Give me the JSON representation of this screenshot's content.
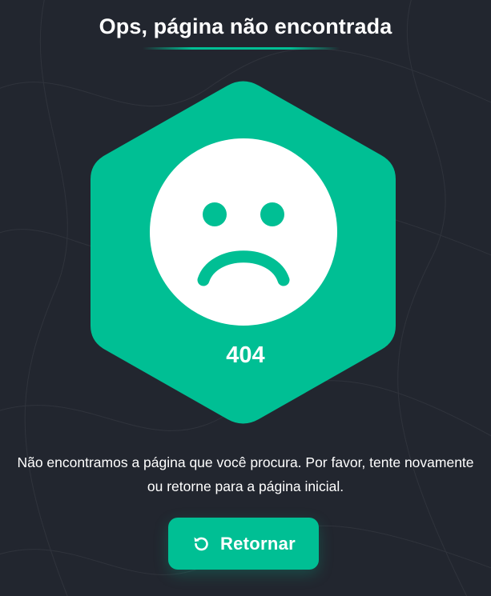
{
  "page": {
    "title": "Ops, página não encontrada",
    "error_code": "404",
    "message": "Não encontramos a página que você procura. Por favor, tente novamente ou retorne para a página inicial."
  },
  "button": {
    "label": "Retornar",
    "icon": "rotate-ccw-icon"
  },
  "illustration": {
    "icon": "sad-face-icon",
    "shape": "hexagon"
  },
  "colors": {
    "background": "#22262f",
    "accent": "#00bf94",
    "text": "#ffffff",
    "face": "#ffffff"
  }
}
